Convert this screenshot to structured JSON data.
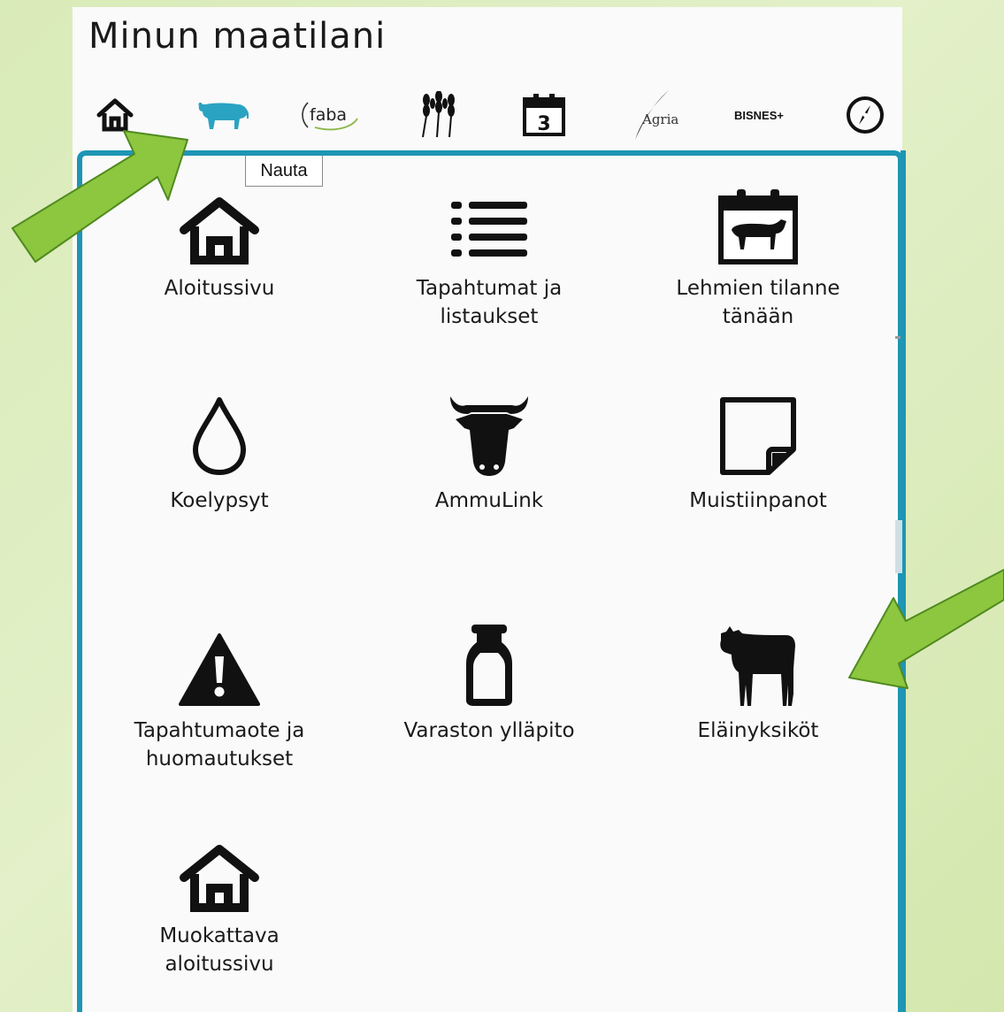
{
  "app": {
    "title": "Minun maatilani"
  },
  "topnav": [
    {
      "id": "home",
      "icon": "home-icon"
    },
    {
      "id": "nauta",
      "icon": "cow-icon",
      "color": "#2aa3c2"
    },
    {
      "id": "faba",
      "icon": "faba-logo",
      "text": "faba"
    },
    {
      "id": "crops",
      "icon": "wheat-icon"
    },
    {
      "id": "calendar",
      "icon": "calendar-icon",
      "text": "3"
    },
    {
      "id": "agria",
      "icon": "agria-logo",
      "text": "Agria"
    },
    {
      "id": "bisnes",
      "icon": "bisnes-logo",
      "text": "BISNES+"
    },
    {
      "id": "compass",
      "icon": "compass-icon"
    }
  ],
  "tooltip": {
    "text": "Nauta"
  },
  "menu": {
    "items": [
      {
        "label": "Aloitussivu",
        "icon": "home-icon"
      },
      {
        "label": "Tapahtumat ja\nlistaukset",
        "icon": "list-icon"
      },
      {
        "label": "Lehmien tilanne\ntänään",
        "icon": "calendar-cow-icon"
      },
      {
        "label": "Koelypsyt",
        "icon": "drop-icon"
      },
      {
        "label": "AmmuLink",
        "icon": "cow-head-icon"
      },
      {
        "label": "Muistiinpanot",
        "icon": "note-icon"
      },
      {
        "label": "Tapahtumaote ja\nhuomautukset",
        "icon": "warning-icon"
      },
      {
        "label": "Varaston ylläpito",
        "icon": "milk-can-icon"
      },
      {
        "label": "Eläinyksiköt",
        "icon": "calf-icon"
      },
      {
        "label": "Muokattava\naloitussivu",
        "icon": "home-icon"
      }
    ]
  },
  "colors": {
    "accent": "#1e96b4",
    "arrow": "#8dc63f",
    "arrow_border": "#4f8a1f"
  }
}
